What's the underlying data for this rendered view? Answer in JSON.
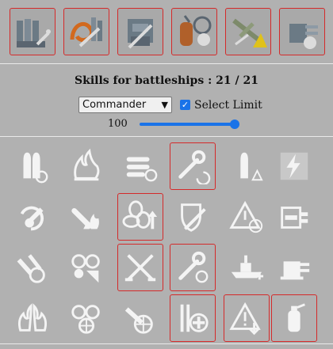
{
  "upgrades": [
    {
      "name": "main-battery-mod-icon"
    },
    {
      "name": "aa-guns-mod-icon"
    },
    {
      "name": "steering-gears-mod-icon"
    },
    {
      "name": "damage-control-mod-icon"
    },
    {
      "name": "aircraft-mod-icon"
    },
    {
      "name": "secondary-battery-mod-icon"
    }
  ],
  "header": {
    "title": "Skills for battleships : 21 / 21"
  },
  "controls": {
    "commander_select": "Commander",
    "select_limit_label": "Select Limit",
    "select_limit_checked": true,
    "level_value": "100",
    "slider_fraction": 1.0
  },
  "skills": [
    {
      "name": "shell-reload-icon",
      "selected": false
    },
    {
      "name": "fire-icon",
      "selected": false
    },
    {
      "name": "torpedo-reload-icon",
      "selected": false
    },
    {
      "name": "wrench-reload-icon",
      "selected": true
    },
    {
      "name": "shell-warning-icon",
      "selected": false
    },
    {
      "name": "lightning-icon",
      "selected": false
    },
    {
      "name": "ap-shell-spin-icon",
      "selected": false
    },
    {
      "name": "shell-fire-icon",
      "selected": false
    },
    {
      "name": "fan-up-icon",
      "selected": true
    },
    {
      "name": "shield-sword-icon",
      "selected": false
    },
    {
      "name": "warning-target-icon",
      "selected": false
    },
    {
      "name": "battery-icon",
      "selected": false
    },
    {
      "name": "shells-fire-icon",
      "selected": false
    },
    {
      "name": "aa-shells-icon",
      "selected": false
    },
    {
      "name": "crossed-swords-icon",
      "selected": true
    },
    {
      "name": "wrench-clock-icon",
      "selected": true
    },
    {
      "name": "battleship-plus-icon",
      "selected": false
    },
    {
      "name": "turret-icon",
      "selected": false
    },
    {
      "name": "fire-hands-icon",
      "selected": false
    },
    {
      "name": "target-shells-icon",
      "selected": false
    },
    {
      "name": "target-shell-reload-icon",
      "selected": false
    },
    {
      "name": "tools-plus-icon",
      "selected": true
    },
    {
      "name": "warning-down-icon",
      "selected": true
    },
    {
      "name": "extinguisher-icon",
      "selected": true
    }
  ]
}
